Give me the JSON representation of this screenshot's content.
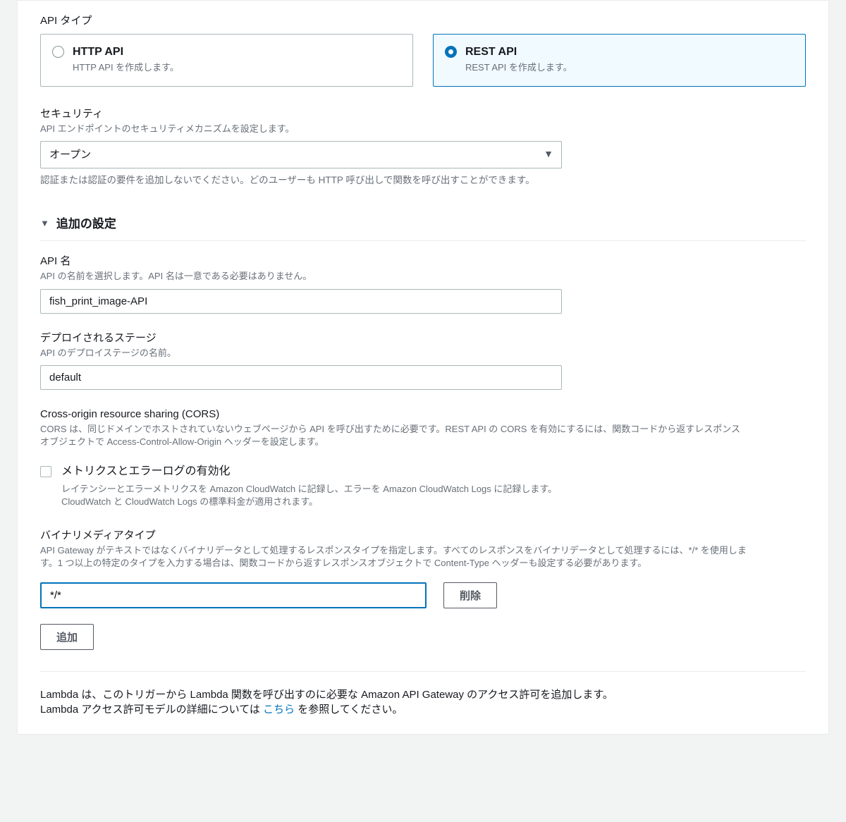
{
  "api_type": {
    "label": "API タイプ",
    "options": [
      {
        "title": "HTTP API",
        "sub": "HTTP API を作成します。"
      },
      {
        "title": "REST API",
        "sub": "REST API を作成します。"
      }
    ]
  },
  "security": {
    "label": "セキュリティ",
    "desc": "API エンドポイントのセキュリティメカニズムを設定します。",
    "selected": "オープン",
    "help": "認証または認証の要件を追加しないでください。どのユーザーも HTTP 呼び出しで関数を呼び出すことができます。"
  },
  "additional": {
    "title": "追加の設定"
  },
  "api_name": {
    "label": "API 名",
    "desc": "API の名前を選択します。API 名は一意である必要はありません。",
    "value": "fish_print_image-API"
  },
  "stage": {
    "label": "デプロイされるステージ",
    "desc": "API のデプロイステージの名前。",
    "value": "default"
  },
  "cors": {
    "label": "Cross-origin resource sharing (CORS)",
    "desc": "CORS は、同じドメインでホストされていないウェブページから API を呼び出すために必要です。REST API の CORS を有効にするには、関数コードから返すレスポンスオブジェクトで Access-Control-Allow-Origin ヘッダーを設定します。"
  },
  "metrics": {
    "label": "メトリクスとエラーログの有効化",
    "desc": "レイテンシーとエラーメトリクスを Amazon CloudWatch に記録し、エラーを Amazon CloudWatch Logs に記録します。CloudWatch と CloudWatch Logs の標準料金が適用されます。"
  },
  "binary": {
    "label": "バイナリメディアタイプ",
    "desc": "API Gateway がテキストではなくバイナリデータとして処理するレスポンスタイプを指定します。すべてのレスポンスをバイナリデータとして処理するには、*/* を使用します。1 つ以上の特定のタイプを入力する場合は、関数コードから返すレスポンスオブジェクトで Content-Type ヘッダーも設定する必要があります。",
    "value": "*/*",
    "delete_label": "削除",
    "add_label": "追加"
  },
  "footer": {
    "text_a": "Lambda は、このトリガーから Lambda 関数を呼び出すのに必要な Amazon API Gateway のアクセス許可を追加します。",
    "text_b_prefix": "Lambda アクセス許可モデルの詳細については ",
    "link": "こちら",
    "text_b_suffix": " を参照してください。"
  }
}
